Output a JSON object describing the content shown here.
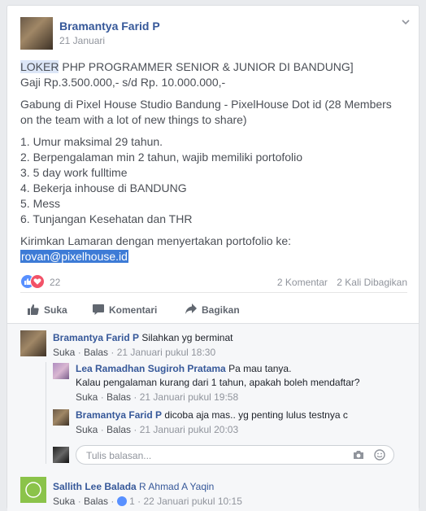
{
  "post": {
    "author": "Bramantya Farid P",
    "date": "21 Januari",
    "lines": {
      "loker": "LOKER",
      "title_rest": " PHP PROGRAMMER SENIOR & JUNIOR DI BANDUNG]",
      "salary": "Gaji Rp.3.500.000,- s/d Rp. 10.000.000,-",
      "join_1": "Gabung di Pixel House Studio Bandung - PixelHouse Dot id (28 Members",
      "join_2": "on the team with a lot of new things to share)",
      "req_1": "1. Umur maksimal 29 tahun.",
      "req_2": "2. Berpengalaman min 2 tahun, wajib memiliki portofolio",
      "req_3": "3. 5 day work fulltime",
      "req_4": "4. Bekerja inhouse di BANDUNG",
      "req_5": "5. Mess",
      "req_6": "6. Tunjangan Kesehatan dan THR",
      "send": "Kirimkan Lamaran dengan menyertakan portofolio ke:",
      "email": "rovan@pixelhouse.id"
    }
  },
  "reactions": {
    "count": "22",
    "comments": "2 Komentar",
    "shares": "2 Kali Dibagikan"
  },
  "actions": {
    "like": "Suka",
    "comment": "Komentari",
    "share": "Bagikan"
  },
  "comments": [
    {
      "author": "Bramantya Farid P",
      "text": "Silahkan yg berminat",
      "like": "Suka",
      "reply": "Balas",
      "time": "21 Januari pukul 18:30"
    },
    {
      "author": "Lea Ramadhan Sugiroh Pratama",
      "text": "Pa mau tanya.",
      "text2": "Kalau pengalaman kurang dari 1 tahun, apakah boleh mendaftar?",
      "like": "Suka",
      "reply": "Balas",
      "time": "21 Januari pukul 19:58"
    },
    {
      "author": "Bramantya Farid P",
      "text": "dicoba aja mas.. yg penting lulus testnya c",
      "like": "Suka",
      "reply": "Balas",
      "time": "21 Januari pukul 20:03"
    },
    {
      "author": "Sallith Lee Balada",
      "text": "R Ahmad A Yaqin",
      "like": "Suka",
      "reply": "Balas",
      "likes": "1",
      "time": "22 Januari pukul 10:15"
    }
  ],
  "reply_box": {
    "placeholder": "Tulis balasan..."
  },
  "colors": {
    "link": "#365899",
    "accent": "#3d7bd6",
    "like": "#5890ff",
    "love": "#f25268"
  }
}
